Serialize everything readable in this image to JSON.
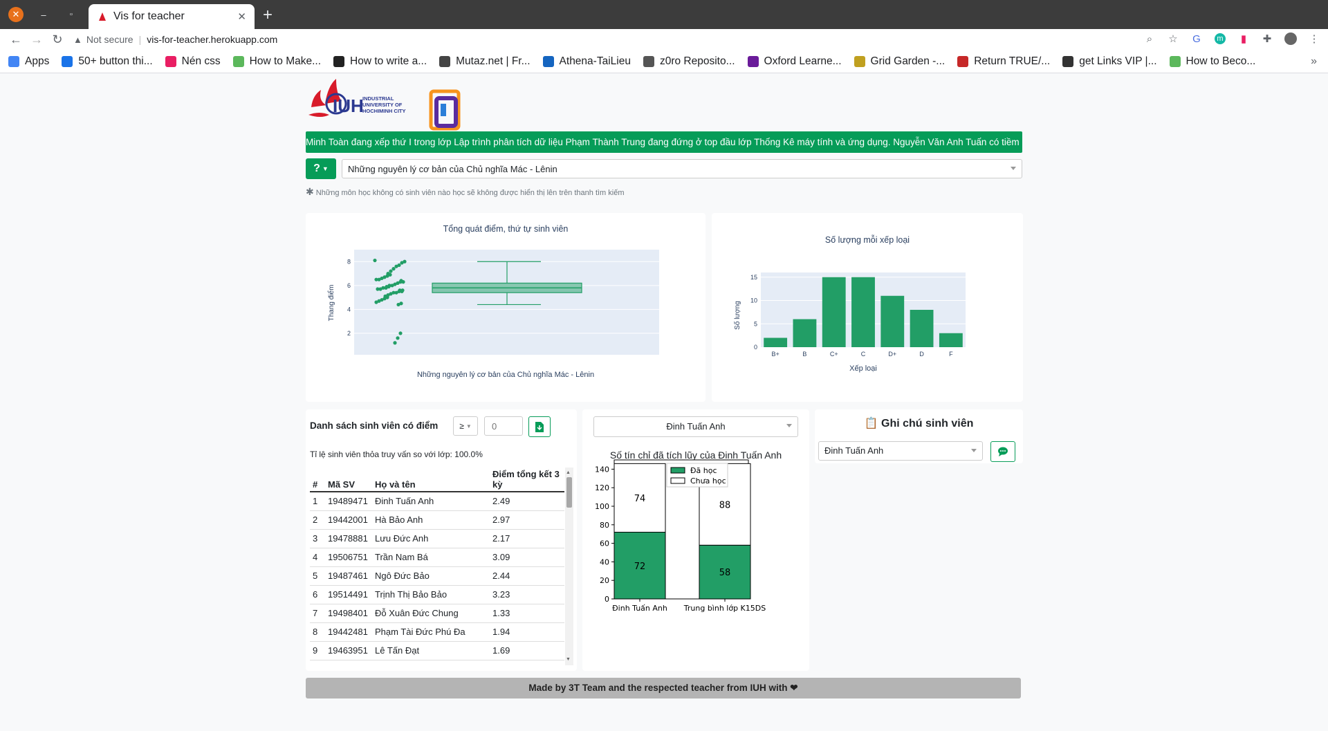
{
  "browser": {
    "tab_title": "Vis for teacher",
    "url_warning": "Not secure",
    "url": "vis-for-teacher.herokuapp.com",
    "bookmarks": [
      "Apps",
      "50+ button thi...",
      "Nén css",
      "How to Make...",
      "How to write a...",
      "Mutaz.net | Fr...",
      "Athena-TaiLieu",
      "z0ro Reposito...",
      "Oxford Learne...",
      "Grid Garden -...",
      "Return TRUE/...",
      "get Links VIP |...",
      "How to Beco..."
    ],
    "bookmark_colors": [
      "#4285f4",
      "#1a73e8",
      "#e91e63",
      "#5cb85c",
      "#222222",
      "#444444",
      "#1565c0",
      "#555555",
      "#6a1b9a",
      "#c0a020",
      "#c62828",
      "#333333",
      "#5cb85c"
    ]
  },
  "header": {
    "logo_text_line1": "INDUSTRIAL",
    "logo_text_line2": "UNIVERSITY OF",
    "logo_text_line3": "HOCHIMINH CITY",
    "logo_mark": "IUH"
  },
  "marquee_text": "Minh Toàn đang xếp thứ I trong lớp Lập trình phân tích dữ liệu Phạm Thành Trung đang đứng ở top đầu lớp Thống Kê máy tính và ứng dụng. Nguyễn Văn Anh Tuấn có tiềm năng thoát top",
  "controls": {
    "help_label": "?",
    "course_selected": "Những nguyên lý cơ bản của Chủ nghĩa Mác - Lênin",
    "note": "Những môn học không có sinh viên nào học sẽ không được hiển thị lên trên thanh tìm kiếm"
  },
  "box_plot": {
    "title": "Tổng quát điểm, thứ tự sinh viên",
    "ylabel": "Thang điểm",
    "xlabel": "Những nguyên lý cơ bản của Chủ nghĩa Mác - Lênin",
    "yticks": [
      "2",
      "4",
      "6",
      "8"
    ],
    "color": "#229e66"
  },
  "chart_data": [
    {
      "type": "bar",
      "title": "Số lượng mỗi xếp loại",
      "xlabel": "Xếp loại",
      "ylabel": "Số lượng",
      "categories": [
        "B+",
        "B",
        "C+",
        "C",
        "D+",
        "D",
        "F"
      ],
      "values": [
        2,
        6,
        15,
        15,
        11,
        8,
        3
      ],
      "ylim": [
        0,
        16
      ],
      "yticks": [
        "0",
        "5",
        "10",
        "15"
      ],
      "color": "#229e66"
    },
    {
      "type": "bar",
      "title": "Số tín chỉ đã tích lũy của Đinh Tuấn Anh",
      "categories": [
        "Đinh Tuấn Anh",
        "Trung bình lớp K15DS"
      ],
      "series": [
        {
          "name": "Đã học",
          "values": [
            72,
            58
          ]
        },
        {
          "name": "Chưa học",
          "values": [
            74,
            88
          ]
        }
      ],
      "ylim": [
        0,
        150
      ],
      "yticks": [
        "0",
        "20",
        "40",
        "60",
        "80",
        "100",
        "120",
        "140"
      ],
      "legend": "top-center",
      "stacked": true
    }
  ],
  "student_list": {
    "title": "Danh sách sinh viên có điểm",
    "operator": "≥",
    "threshold_placeholder": "0",
    "ratio_text": "Tỉ lệ sinh viên thỏa truy vấn so với lớp: 100.0%",
    "headers": [
      "#",
      "Mã SV",
      "Họ và tên",
      "Điểm tổng kết 3 kỳ"
    ],
    "rows": [
      [
        "1",
        "19489471",
        "Đinh Tuấn Anh",
        "2.49"
      ],
      [
        "2",
        "19442001",
        "Hà Bảo Anh",
        "2.97"
      ],
      [
        "3",
        "19478881",
        "Lưu Đức Anh",
        "2.17"
      ],
      [
        "4",
        "19506751",
        "Trần Nam Bá",
        "3.09"
      ],
      [
        "5",
        "19487461",
        "Ngô Đức Bảo",
        "2.44"
      ],
      [
        "6",
        "19514491",
        "Trịnh Thị Bảo Bảo",
        "3.23"
      ],
      [
        "7",
        "19498401",
        "Đỗ Xuân Đức Chung",
        "1.33"
      ],
      [
        "8",
        "19442481",
        "Phạm Tài Đức Phú Đa",
        "1.94"
      ],
      [
        "9",
        "19463951",
        "Lê Tấn Đạt",
        "1.69"
      ]
    ]
  },
  "credit_panel": {
    "student_selected": "Đinh Tuấn Anh"
  },
  "notes_panel": {
    "title": "📋 Ghi chú sinh viên",
    "student_selected": "Đinh Tuấn Anh"
  },
  "footer": "Made by 3T Team and the respected teacher from IUH with ❤"
}
